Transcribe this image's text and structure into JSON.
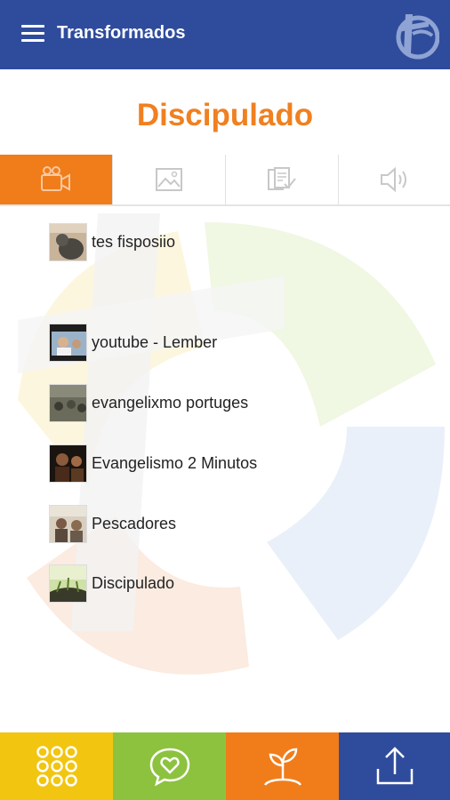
{
  "appbar": {
    "title": "Transformados",
    "menu_icon": "hamburger-menu-icon",
    "logo_icon": "brand-logo",
    "color": "#2f4c9c"
  },
  "page": {
    "title": "Discipulado",
    "title_color": "#f08020"
  },
  "tabs": [
    {
      "icon": "video-camera-icon",
      "active": true
    },
    {
      "icon": "image-icon",
      "active": false
    },
    {
      "icon": "documents-icon",
      "active": false
    },
    {
      "icon": "speaker-icon",
      "active": false
    }
  ],
  "videos": [
    {
      "label": "tes fisposiio"
    },
    {
      "label": "youtube - Lember"
    },
    {
      "label": "evangelixmo portuges"
    },
    {
      "label": "Evangelismo 2 Minutos"
    },
    {
      "label": "Pescadores"
    },
    {
      "label": "Discipulado"
    }
  ],
  "bottom_nav": [
    {
      "icon": "grid-dots-icon",
      "color": "#f2c511"
    },
    {
      "icon": "heart-chat-icon",
      "color": "#8dc23f"
    },
    {
      "icon": "sprout-icon",
      "color": "#f07d1a"
    },
    {
      "icon": "share-upload-icon",
      "color": "#2f4c9c"
    }
  ],
  "accent_color": "#f07d1a"
}
